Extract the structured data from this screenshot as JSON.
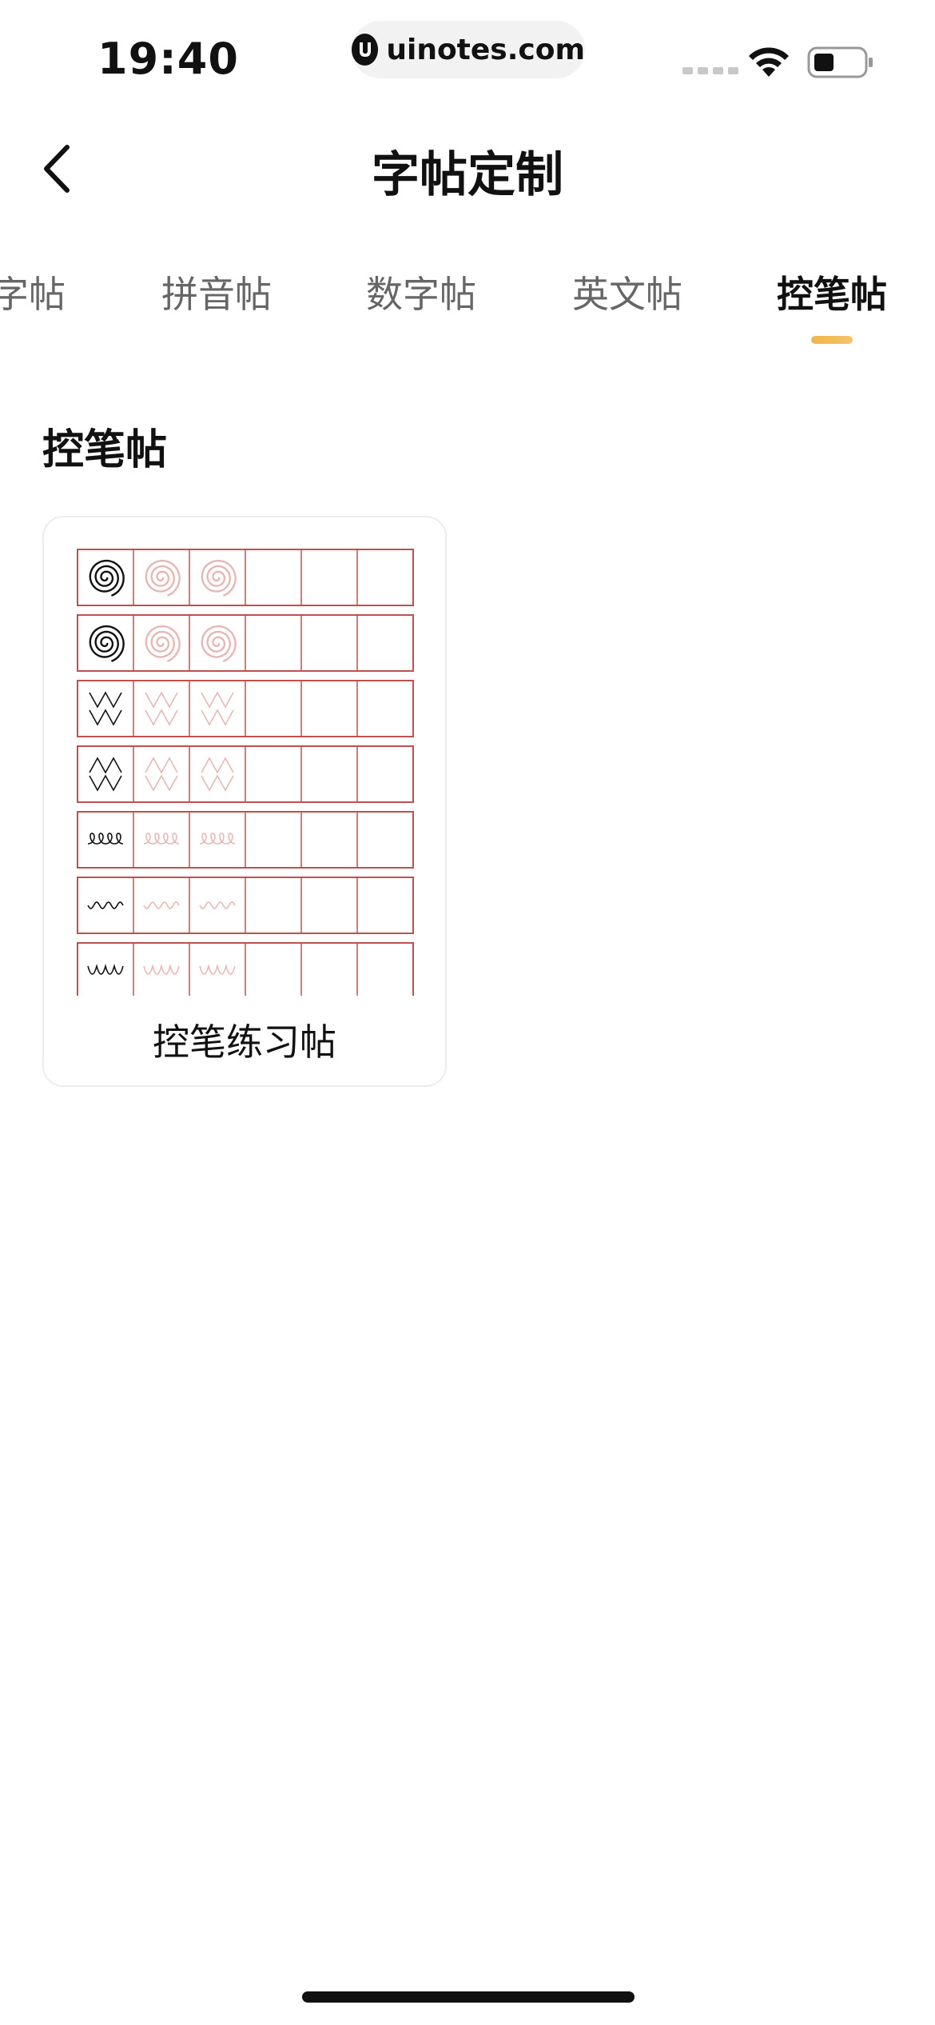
{
  "status_bar": {
    "time": "19:40",
    "url": "uinotes.com",
    "icons": [
      "signal-icon",
      "wifi-icon",
      "battery-icon"
    ]
  },
  "nav": {
    "title": "字帖定制",
    "back_icon": "chevron-left-icon"
  },
  "tabs": [
    {
      "label": "字帖",
      "active": false
    },
    {
      "label": "拼音帖",
      "active": false
    },
    {
      "label": "数字帖",
      "active": false
    },
    {
      "label": "英文帖",
      "active": false
    },
    {
      "label": "控笔帖",
      "active": true
    }
  ],
  "section": {
    "title": "控笔帖",
    "cards": [
      {
        "label": "控笔练习帖"
      }
    ]
  },
  "colors": {
    "accent": "#f0b64a",
    "grid": "#c0504d",
    "trace": "#e6b8b5"
  }
}
